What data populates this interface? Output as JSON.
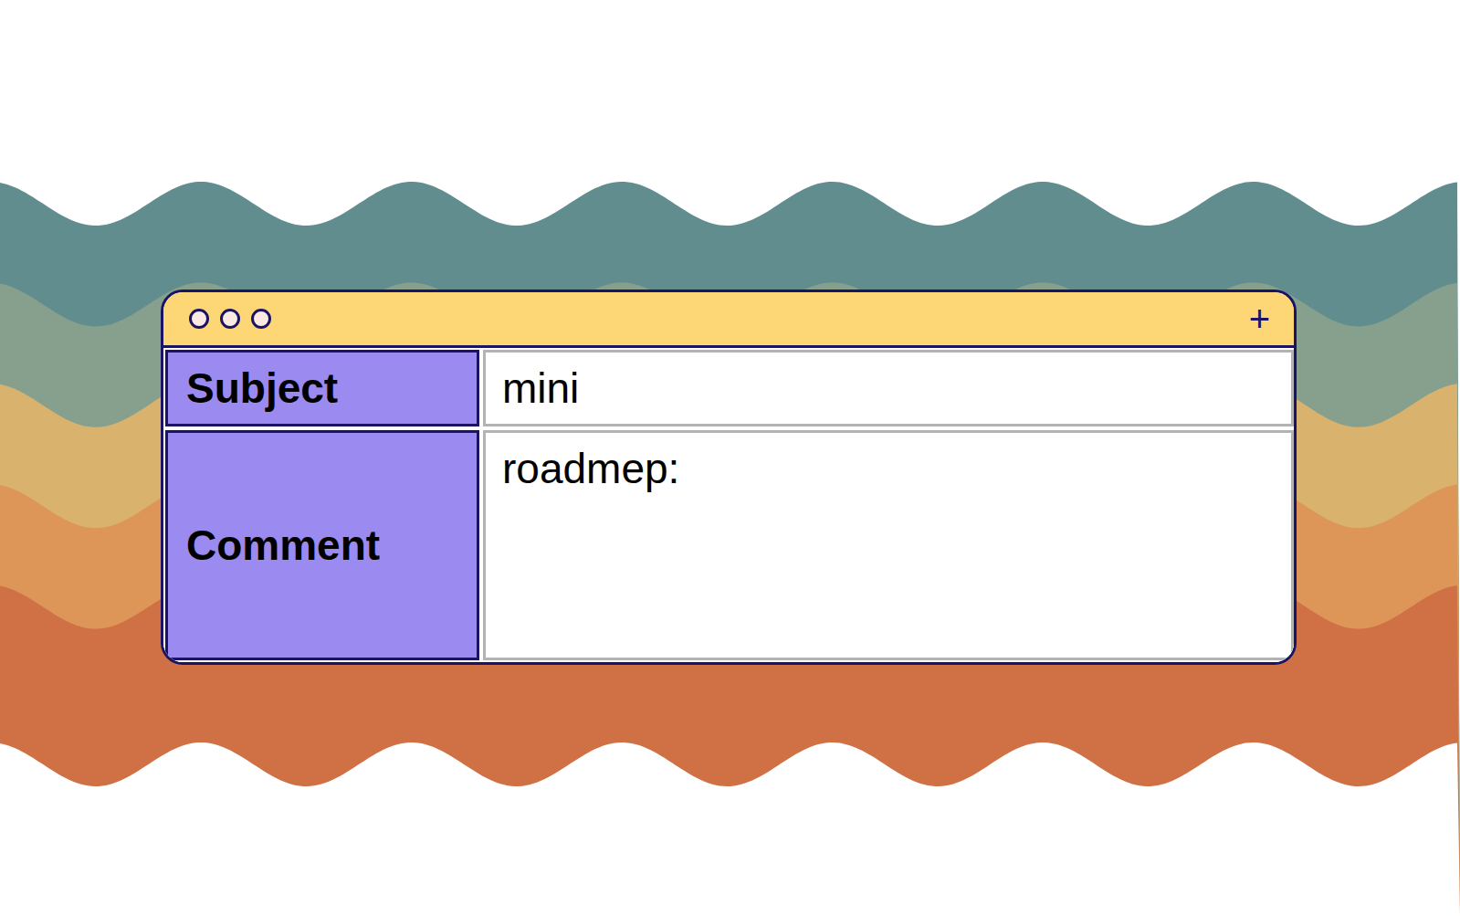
{
  "toolbar": {
    "add_button": "+"
  },
  "form": {
    "rows": [
      {
        "label": "Subject",
        "value": "mini",
        "kind": "single-line"
      },
      {
        "label": "Comment",
        "value": "roadmep:",
        "kind": "multi-line"
      }
    ]
  }
}
